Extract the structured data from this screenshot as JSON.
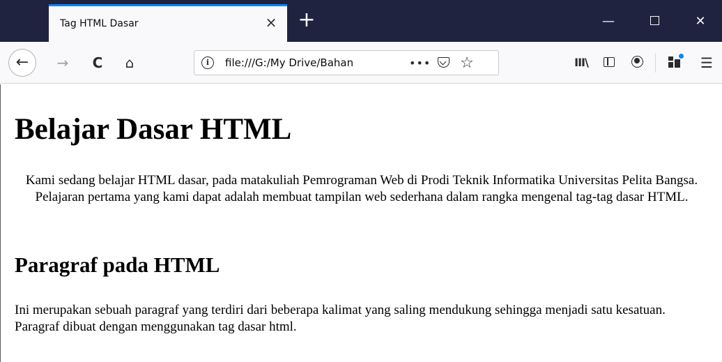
{
  "tab": {
    "title": "Tag HTML Dasar",
    "close_glyph": "×"
  },
  "new_tab_glyph": "+",
  "window": {
    "minimize_glyph": "—",
    "close_glyph": "✕"
  },
  "nav": {
    "back_glyph": "←",
    "forward_glyph": "→",
    "reload_glyph": "C",
    "home_glyph": "⌂"
  },
  "url": {
    "info_glyph": "i",
    "text": "file:///G:/My Drive/Bahan",
    "page_actions_glyph": "•••",
    "bookmark_glyph": "☆"
  },
  "toolbar": {
    "library_glyph": "III\\",
    "menu_glyph": "☰"
  },
  "icons": {
    "back": "back-arrow-icon",
    "forward": "forward-arrow-icon",
    "reload": "reload-icon",
    "home": "home-icon",
    "site_info": "info-icon",
    "page_actions": "more-icon",
    "pocket": "pocket-icon",
    "bookmark": "star-icon",
    "library": "library-icon",
    "sidebar": "sidebar-icon",
    "account": "account-icon",
    "extension": "extension-icon",
    "menu": "hamburger-menu-icon"
  },
  "colors": {
    "titlebar": "#1f2340",
    "tab_accent": "#0a84ff",
    "toolbar": "#f9f9fb"
  },
  "page": {
    "title": "Belajar Dasar HTML",
    "intro": "Kami sedang belajar HTML dasar, pada matakuliah Pemrograman Web di Prodi Teknik Informatika Universitas Pelita Bangsa. Pelajaran pertama yang kami dapat adalah membuat tampilan web sederhana dalam rangka mengenal tag-tag dasar HTML.",
    "section_heading": "Paragraf pada HTML",
    "section_paragraph": "Ini merupakan sebuah paragraf yang terdiri dari beberapa kalimat yang saling mendukung sehingga menjadi satu kesatuan. Paragraf dibuat dengan menggunakan tag dasar html."
  }
}
